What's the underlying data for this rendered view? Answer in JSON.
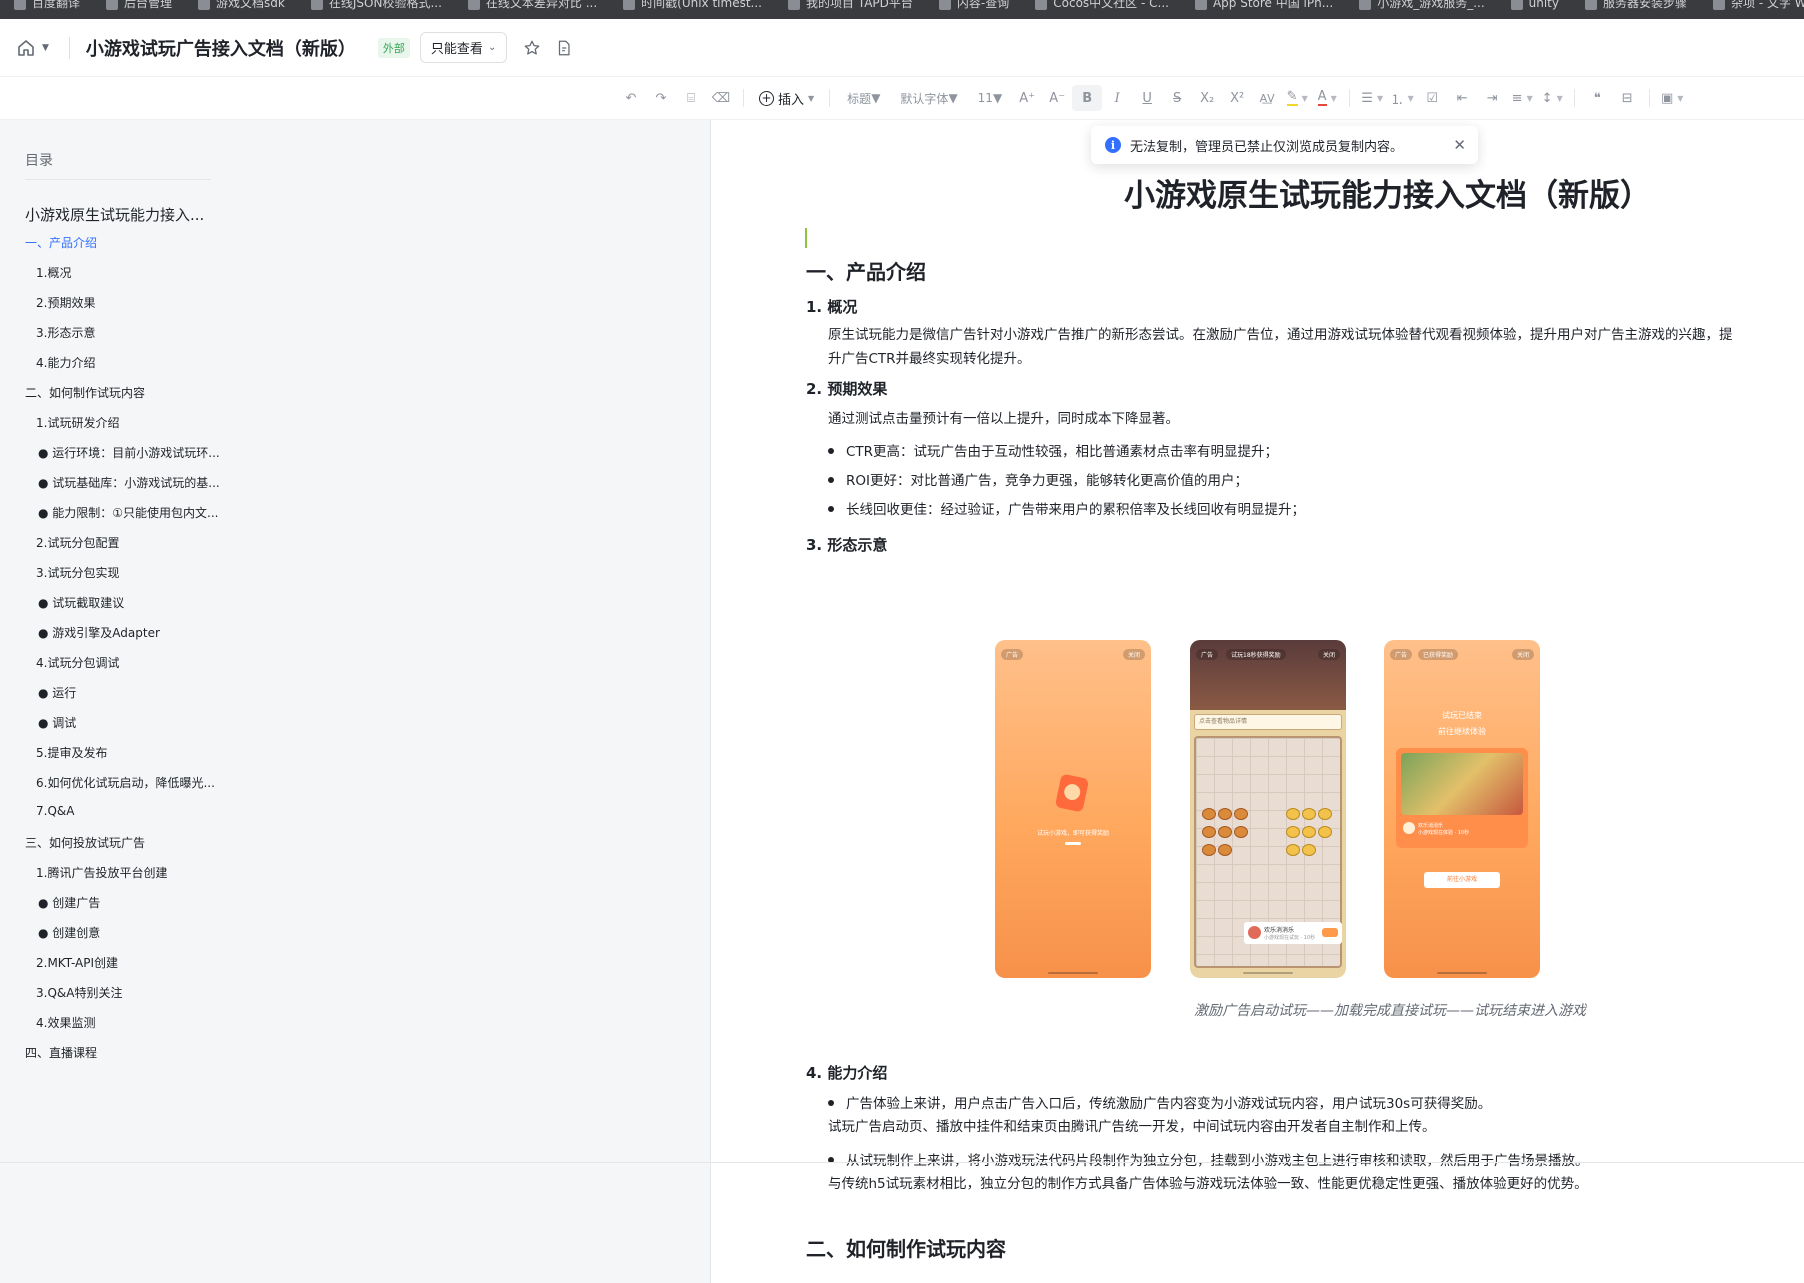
{
  "bookmarks": [
    {
      "label": "百度翻译",
      "icon": "bookmark-icon"
    },
    {
      "label": "后台管理",
      "icon": "folder-icon"
    },
    {
      "label": "游戏文档sdk",
      "icon": "folder-icon"
    },
    {
      "label": "在线JSON校验格式...",
      "icon": "bookmark-icon"
    },
    {
      "label": "在线文本差异对比 ...",
      "icon": "bookmark-icon"
    },
    {
      "label": "时间戳(Unix timest...",
      "icon": "bookmark-icon"
    },
    {
      "label": "我的项目 TAPD平台",
      "icon": "bookmark-icon"
    },
    {
      "label": "内容-查询",
      "icon": "bookmark-icon"
    },
    {
      "label": "Cocos中文社区 - C...",
      "icon": "bookmark-icon"
    },
    {
      "label": "App Store 中国 iPh...",
      "icon": "bookmark-icon"
    },
    {
      "label": "小游戏_游戏服务_...",
      "icon": "bookmark-icon"
    },
    {
      "label": "unity",
      "icon": "folder-icon"
    },
    {
      "label": "服务器安装步骤",
      "icon": "folder-icon"
    },
    {
      "label": "杂项 - 文字 Wordle",
      "icon": "bookmark-icon"
    }
  ],
  "titlebar": {
    "home_icon": "home-icon",
    "title": "小游戏试玩广告接入文档（新版）",
    "tag": "外部",
    "mode_label": "只能查看",
    "star_icon": "star-icon",
    "doc_icon": "document-info-icon"
  },
  "toolbar": {
    "insert_label": "插入",
    "heading_label": "标题",
    "font_label": "默认字体",
    "size_label": "11",
    "glyphs": {
      "bold": "B",
      "italic": "I",
      "underline": "U",
      "strike": "S",
      "subscript": "X₂",
      "superscript": "X²"
    }
  },
  "toc": {
    "title": "目录",
    "items": [
      {
        "label": "小游戏原生试玩能力接入...",
        "level": 0
      },
      {
        "label": "一、产品介绍",
        "level": 1,
        "active": true
      },
      {
        "label": "1.概况",
        "level": 2
      },
      {
        "label": "2.预期效果",
        "level": 2
      },
      {
        "label": "3.形态示意",
        "level": 2
      },
      {
        "label": "4.能力介绍",
        "level": 2
      },
      {
        "label": "二、如何制作试玩内容",
        "level": 1
      },
      {
        "label": "1.试玩研发介绍",
        "level": 2
      },
      {
        "label": "● 运行环境：目前小游戏试玩环...",
        "level": 3
      },
      {
        "label": "● 试玩基础库：小游戏试玩的基...",
        "level": 3
      },
      {
        "label": "● 能力限制：①只能使用包内文...",
        "level": 3
      },
      {
        "label": "2.试玩分包配置",
        "level": 2
      },
      {
        "label": "3.试玩分包实现",
        "level": 2
      },
      {
        "label": "● 试玩截取建议",
        "level": 3
      },
      {
        "label": "● 游戏引擎及Adapter",
        "level": 3
      },
      {
        "label": "4.试玩分包调试",
        "level": 2
      },
      {
        "label": "● 运行",
        "level": 3
      },
      {
        "label": "● 调试",
        "level": 3
      },
      {
        "label": "5.提审及发布",
        "level": 2
      },
      {
        "label": "6.如何优化试玩启动，降低曝光...",
        "level": 2
      },
      {
        "label": "7.Q&A",
        "level": 2
      },
      {
        "label": "三、如何投放试玩广告",
        "level": 1
      },
      {
        "label": "1.腾讯广告投放平台创建",
        "level": 2
      },
      {
        "label": "● 创建广告",
        "level": 3
      },
      {
        "label": "● 创建创意",
        "level": 3
      },
      {
        "label": "2.MKT-API创建",
        "level": 2
      },
      {
        "label": "3.Q&A特别关注",
        "level": 2
      },
      {
        "label": "4.效果监测",
        "level": 2
      },
      {
        "label": "四、直播课程",
        "level": 1
      }
    ]
  },
  "toast": {
    "text": "无法复制，管理员已禁止仅浏览成员复制内容。"
  },
  "doc": {
    "title": "小游戏原生试玩能力接入文档（新版）",
    "section1_title": "一、产品介绍",
    "s1_1_title": "1.  概况",
    "s1_1_text": "原生试玩能力是微信广告针对小游戏广告推广的新形态尝试。在激励广告位，通过用游戏试玩体验替代观看视频体验，提升用户对广告主游戏的兴趣，提升广告CTR并最终实现转化提升。",
    "s1_2_title": "2.  预期效果",
    "s1_2_intro": "通过测试点击量预计有一倍以上提升，同时成本下降显著。",
    "s1_2_bullets": [
      "CTR更高：试玩广告由于互动性较强，相比普通素材点击率有明显提升；",
      "ROI更好：对比普通广告，竞争力更强，能够转化更高价值的用户；",
      "长线回收更佳：经过验证，广告带来用户的累积倍率及长线回收有明显提升；"
    ],
    "s1_3_title": "3.  形态示意",
    "phones": {
      "p1_badge_left": "广告",
      "p1_badge_right": "关闭",
      "p1_caption": "试玩小游戏，即可获得奖励",
      "p2_badge_left": "广告",
      "p2_badge_center": "试玩18秒获得奖励",
      "p2_badge_right": "关闭",
      "p2_search": "点击查看物品详情",
      "p2_card_title": "欢乐消消乐",
      "p2_card_sub": "小游戏现在试玩 · 10秒",
      "p3_badge_left": "广告",
      "p3_badge_center": "已获得奖励",
      "p3_badge_right": "关闭",
      "p3_title1": "试玩已结束",
      "p3_title2": "前往继续体验",
      "p3_card_title": "欢乐消消乐",
      "p3_card_sub": "小游戏现在体验 · 10秒",
      "p3_button": "前往小游戏"
    },
    "caption": "激励广告启动试玩——加载完成直接试玩——试玩结束进入游戏",
    "s1_4_title": "4.  能力介绍",
    "s1_4_b1": "广告体验上来讲，用户点击广告入口后，传统激励广告内容变为小游戏试玩内容，用户试玩30s可获得奖励。",
    "s1_4_p1": "试玩广告启动页、播放中挂件和结束页由腾讯广告统一开发，中间试玩内容由开发者自主制作和上传。",
    "s1_4_b2": "从试玩制作上来讲，将小游戏玩法代码片段制作为独立分包，挂载到小游戏主包上进行审核和读取，然后用于广告场景播放。",
    "s1_4_p2": "与传统h5试玩素材相比，独立分包的制作方式具备广告体验与游戏玩法体验一致、性能更优稳定性更强、播放体验更好的优势。",
    "section2_title": "二、如何制作试玩内容"
  },
  "colors": {
    "accent": "#3370ff",
    "tag_green": "#34a853",
    "phone_orange": "#ffa85e"
  }
}
